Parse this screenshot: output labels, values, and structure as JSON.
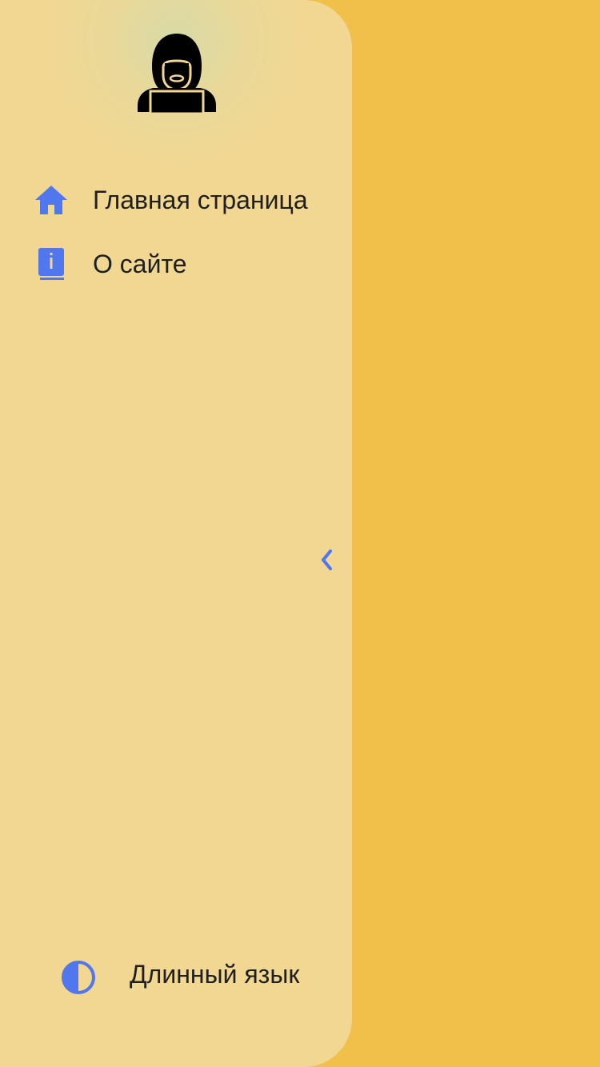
{
  "drawer": {
    "avatar_icon": "hooded-hacker-icon",
    "items": [
      {
        "label": "Главная страница",
        "icon": "home-icon"
      },
      {
        "label": "О сайте",
        "icon": "info-book-icon"
      }
    ],
    "collapse_icon": "chevron-left-icon",
    "theme_toggle": {
      "label": "Длинный язык",
      "icon": "contrast-icon"
    }
  },
  "colors": {
    "background": "#F0C04A",
    "drawer_background": "#F1D792",
    "accent": "#5077EE",
    "text": "#1F1F1F"
  }
}
